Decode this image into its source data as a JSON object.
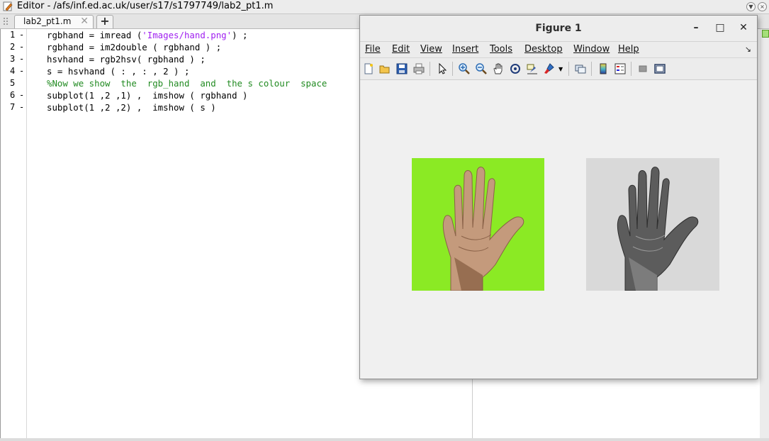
{
  "editor": {
    "window_title": "Editor - /afs/inf.ed.ac.uk/user/s17/s1797749/lab2_pt1.m",
    "tab_label": "lab2_pt1.m",
    "tab_close": "✕",
    "add_tab": "+",
    "lines": [
      {
        "num": "1",
        "dash": "-",
        "parts": [
          {
            "t": "rgbhand = imread (",
            "c": ""
          },
          {
            "t": "'Images/hand.png'",
            "c": "str"
          },
          {
            "t": ") ;",
            "c": ""
          }
        ]
      },
      {
        "num": "2",
        "dash": "-",
        "parts": [
          {
            "t": "rgbhand = im2double ( rgbhand ) ;",
            "c": ""
          }
        ]
      },
      {
        "num": "3",
        "dash": "-",
        "parts": [
          {
            "t": "hsvhand = rgb2hsv( rgbhand ) ;",
            "c": ""
          }
        ]
      },
      {
        "num": "4",
        "dash": "-",
        "parts": [
          {
            "t": "s = hsvhand ( : , : , 2 ) ;",
            "c": ""
          }
        ]
      },
      {
        "num": "5",
        "dash": "",
        "parts": [
          {
            "t": "%Now we show  the  rgb_hand  and  the s colour  space",
            "c": "cmt"
          }
        ]
      },
      {
        "num": "6",
        "dash": "-",
        "parts": [
          {
            "t": "subplot(1 ,2 ,1) ,  imshow ( rgbhand )",
            "c": ""
          }
        ]
      },
      {
        "num": "7",
        "dash": "-",
        "parts": [
          {
            "t": "subplot(1 ,2 ,2) ,  imshow ( s )",
            "c": ""
          }
        ]
      }
    ]
  },
  "figure": {
    "title": "Figure 1",
    "window_buttons": {
      "minimize": "–",
      "maximize": "□",
      "close": "✕"
    },
    "menus": [
      "File",
      "Edit",
      "View",
      "Insert",
      "Tools",
      "Desktop",
      "Window",
      "Help"
    ],
    "menu_more": "↘",
    "toolbar": [
      "new-figure-icon",
      "open-file-icon",
      "save-icon",
      "print-icon",
      "edit-plot-arrow-icon",
      "zoom-in-icon",
      "zoom-out-icon",
      "pan-hand-icon",
      "rotate-3d-icon",
      "data-cursor-icon",
      "brush-icon",
      "brush-dropdown-icon",
      "link-plot-icon",
      "colorbar-icon",
      "legend-icon",
      "hide-plot-tools-icon",
      "show-plot-tools-icon"
    ],
    "images": [
      {
        "name": "rgb-hand-image",
        "background": "#8bea24"
      },
      {
        "name": "saturation-hand-image",
        "background": "#d9d9d9"
      }
    ]
  },
  "colors": {
    "comment": "#228b22",
    "string": "#a020f0",
    "accent_green": "#8bea24"
  }
}
